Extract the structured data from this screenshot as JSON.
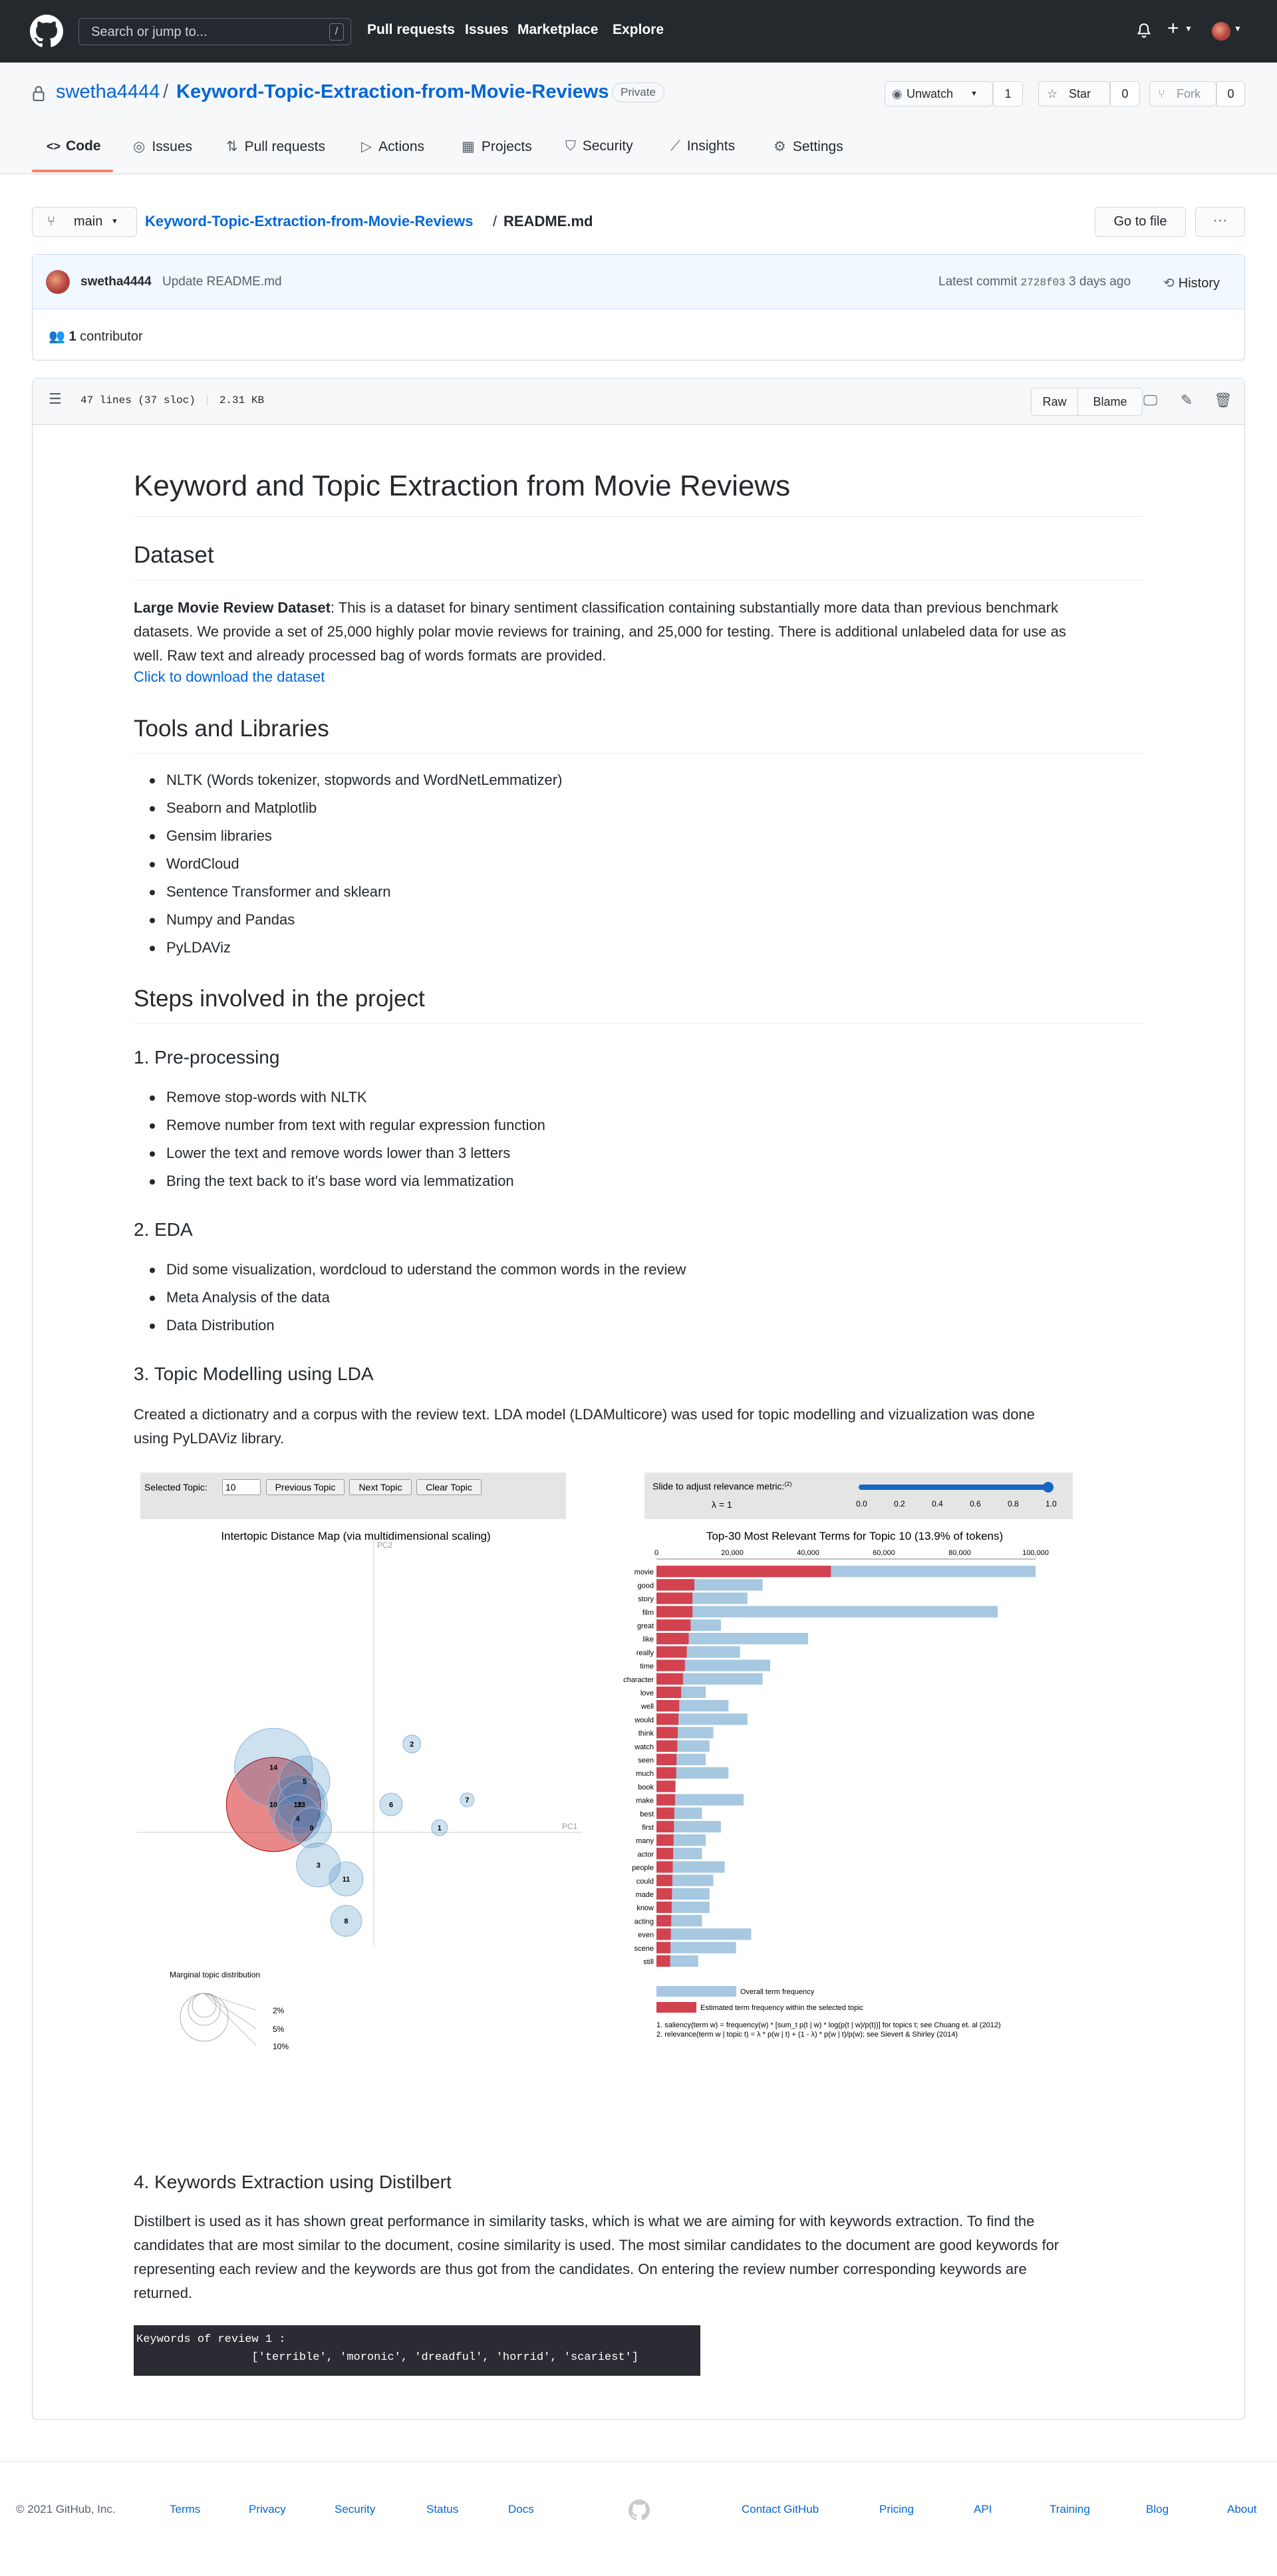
{
  "header": {
    "search_placeholder": "Search or jump to...",
    "search_key": "/",
    "nav": [
      "Pull requests",
      "Issues",
      "Marketplace",
      "Explore"
    ]
  },
  "repo": {
    "owner": "swetha4444",
    "separator": "/",
    "name": "Keyword-Topic-Extraction-from-Movie-Reviews",
    "visibility": "Private",
    "unwatch_label": "Unwatch",
    "watch_count": "1",
    "star_label": "Star",
    "star_count": "0",
    "fork_label": "Fork",
    "fork_count": "0",
    "tabs": [
      "Code",
      "Issues",
      "Pull requests",
      "Actions",
      "Projects",
      "Security",
      "Insights",
      "Settings"
    ]
  },
  "file_nav": {
    "branch": "main",
    "crumb_repo": "Keyword-Topic-Extraction-from-Movie-Reviews",
    "crumb_sep": "/",
    "crumb_file": "README.md",
    "go_to_file": "Go to file",
    "more": "···"
  },
  "commit": {
    "author": "swetha4444",
    "message": "Update README.md",
    "latest_label": "Latest commit",
    "hash": "2728f03",
    "when": "3 days ago",
    "history": "History",
    "contributors_count": "1",
    "contributors_label": "contributor"
  },
  "file": {
    "lines": "47 lines (37 sloc)",
    "size": "2.31 KB",
    "raw": "Raw",
    "blame": "Blame"
  },
  "readme": {
    "title": "Keyword and Topic Extraction from Movie Reviews",
    "dataset_heading": "Dataset",
    "dataset_bold": "Large Movie Review Dataset",
    "dataset_text_1": ": This is a dataset for binary sentiment classification containing substantially more data than previous benchmark",
    "dataset_text_2": "datasets. We provide a set of 25,000 highly polar movie reviews for training, and 25,000 for testing. There is additional unlabeled data for use as",
    "dataset_text_3": "well. Raw text and already processed bag of words formats are provided.",
    "dataset_link": "Click to download the dataset",
    "tools_heading": "Tools and Libraries",
    "tools": [
      "NLTK (Words tokenizer, stopwords and WordNetLemmatizer)",
      "Seaborn and Matplotlib",
      "Gensim libraries",
      "WordCloud",
      "Sentence Transformer and sklearn",
      "Numpy and Pandas",
      "PyLDAViz"
    ],
    "steps_heading": "Steps involved in the project",
    "pre_heading": "1. Pre-processing",
    "pre_items": [
      "Remove stop-words with NLTK",
      "Remove number from text with regular expression function",
      "Lower the text and remove words lower than 3 letters",
      "Bring the text back to it's base word via lemmatization"
    ],
    "eda_heading": "2. EDA",
    "eda_items": [
      "Did some visualization, wordcloud to uderstand the common words in the review",
      "Meta Analysis of the data",
      "Data Distribution"
    ],
    "lda_heading": "3. Topic Modelling using LDA",
    "lda_text_1": "Created a dictionatry and a corpus with the review text. LDA model (LDAMulticore) was used for topic modelling and vizualization was done",
    "lda_text_2": "using PyLDAViz library.",
    "kw_heading": "4. Keywords Extraction using Distilbert",
    "kw_text_1": "Distilbert is used as it has shown great performance in similarity tasks, which is what we are aiming for with keywords extraction. To find the",
    "kw_text_2": "candidates that are most similar to the document, cosine similarity is used. The most similar candidates to the document are good keywords for",
    "kw_text_3": "representing each review and the keywords are thus got from the candidates. On entering the review number corresponding keywords are",
    "kw_text_4": "returned.",
    "code_line_1": "Keywords of review 1 :",
    "code_line_2": "                 ['terrible', 'moronic', 'dreadful', 'horrid', 'scariest']"
  },
  "ldaviz": {
    "selected_topic_label": "Selected Topic:",
    "selected_topic_value": "10",
    "prev_btn": "Previous Topic",
    "next_btn": "Next Topic",
    "clear_btn": "Clear Topic",
    "slider_label": "Slide to adjust relevance metric:",
    "slider_help": "(2)",
    "lambda_label": "λ = 1",
    "slider_ticks": [
      "0.0",
      "0.2",
      "0.4",
      "0.6",
      "0.8",
      "1.0"
    ],
    "slider_value": 1.0,
    "map_title": "Intertopic Distance Map (via multidimensional scaling)",
    "pc2": "PC2",
    "pc1": "PC1",
    "marginal_title": "Marginal topic distribution",
    "marginal_labels": [
      "2%",
      "5%",
      "10%"
    ],
    "bars_title": "Top-30 Most Relevant Terms for Topic 10 (13.9% of tokens)",
    "legend_overall": "Overall term frequency",
    "legend_selected": "Estimated term frequency within the selected topic",
    "note_1": "1. saliency(term w) = frequency(w) * [sum_t p(t | w) * log(p(t | w)/p(t))] for topics t; see Chuang et. al (2012)",
    "note_2": "2. relevance(term w | topic t) = λ * p(w | t) + (1 - λ) * p(w | t)/p(w); see Sievert & Shirley (2014)"
  },
  "chart_data": [
    {
      "type": "scatter",
      "title": "Intertopic Distance Map (via multidimensional scaling)",
      "xlabel": "PC1",
      "ylabel": "PC2",
      "points": [
        {
          "label": "14",
          "x": -0.29,
          "y": 0.14,
          "size": 9.5,
          "color": "#1f77b4"
        },
        {
          "label": "5",
          "x": -0.2,
          "y": 0.11,
          "size": 4.0,
          "color": "#1f77b4"
        },
        {
          "label": "12",
          "x": -0.22,
          "y": 0.06,
          "size": 5.5,
          "color": "#1f77b4"
        },
        {
          "label": "13",
          "x": -0.21,
          "y": 0.06,
          "size": 3.5,
          "color": "#1f77b4"
        },
        {
          "label": "4",
          "x": -0.22,
          "y": 0.03,
          "size": 3.5,
          "color": "#1f77b4"
        },
        {
          "label": "9",
          "x": -0.18,
          "y": 0.01,
          "size": 2.5,
          "color": "#1f77b4"
        },
        {
          "label": "10",
          "x": -0.29,
          "y": 0.06,
          "size": 13.9,
          "color": "#d62728"
        },
        {
          "label": "3",
          "x": -0.16,
          "y": -0.07,
          "size": 3.0,
          "color": "#1f77b4"
        },
        {
          "label": "11",
          "x": -0.08,
          "y": -0.1,
          "size": 1.8,
          "color": "#1f77b4"
        },
        {
          "label": "8",
          "x": -0.08,
          "y": -0.19,
          "size": 1.5,
          "color": "#1f77b4"
        },
        {
          "label": "6",
          "x": 0.05,
          "y": 0.06,
          "size": 0.8,
          "color": "#1f77b4"
        },
        {
          "label": "2",
          "x": 0.11,
          "y": 0.19,
          "size": 0.5,
          "color": "#1f77b4"
        },
        {
          "label": "7",
          "x": 0.27,
          "y": 0.07,
          "size": 0.3,
          "color": "#1f77b4"
        },
        {
          "label": "1",
          "x": 0.19,
          "y": 0.01,
          "size": 0.4,
          "color": "#1f77b4"
        }
      ]
    },
    {
      "type": "bar",
      "orientation": "horizontal",
      "title": "Top-30 Most Relevant Terms for Topic 10 (13.9% of tokens)",
      "xlim": [
        0,
        100000
      ],
      "xticks": [
        "0",
        "20,000",
        "40,000",
        "60,000",
        "80,000",
        "100,000"
      ],
      "categories": [
        "movie",
        "good",
        "story",
        "film",
        "great",
        "like",
        "really",
        "time",
        "character",
        "love",
        "well",
        "would",
        "think",
        "watch",
        "seen",
        "much",
        "book",
        "make",
        "best",
        "first",
        "many",
        "actor",
        "people",
        "could",
        "made",
        "know",
        "acting",
        "even",
        "scene",
        "still"
      ],
      "series": [
        {
          "name": "Overall term frequency",
          "color": "#a6c8e0",
          "values": [
            100000,
            28000,
            24000,
            90000,
            17000,
            40000,
            22000,
            30000,
            28000,
            13000,
            19000,
            24000,
            15000,
            14000,
            13000,
            19000,
            5000,
            23000,
            12000,
            17000,
            13000,
            12000,
            18000,
            15000,
            14000,
            14000,
            12000,
            25000,
            21000,
            11000
          ]
        },
        {
          "name": "Estimated term frequency within the selected topic",
          "color": "#d2424f",
          "values": [
            46000,
            10000,
            9500,
            9500,
            9000,
            8500,
            8000,
            7500,
            7000,
            6500,
            6000,
            5800,
            5600,
            5500,
            5300,
            5200,
            5000,
            4900,
            4700,
            4600,
            4500,
            4400,
            4300,
            4200,
            4100,
            4000,
            3900,
            3800,
            3700,
            3600
          ]
        }
      ]
    }
  ],
  "footer": {
    "copyright": "© 2021 GitHub, Inc.",
    "links": [
      "Terms",
      "Privacy",
      "Security",
      "Status",
      "Docs",
      "Contact GitHub",
      "Pricing",
      "API",
      "Training",
      "Blog",
      "About"
    ]
  },
  "colors": {
    "header_bg": "#24292e",
    "link": "#0366d6",
    "tab_accent": "#f9826c",
    "topic_selected": "#d62728",
    "topic_other": "#1f77b4"
  }
}
